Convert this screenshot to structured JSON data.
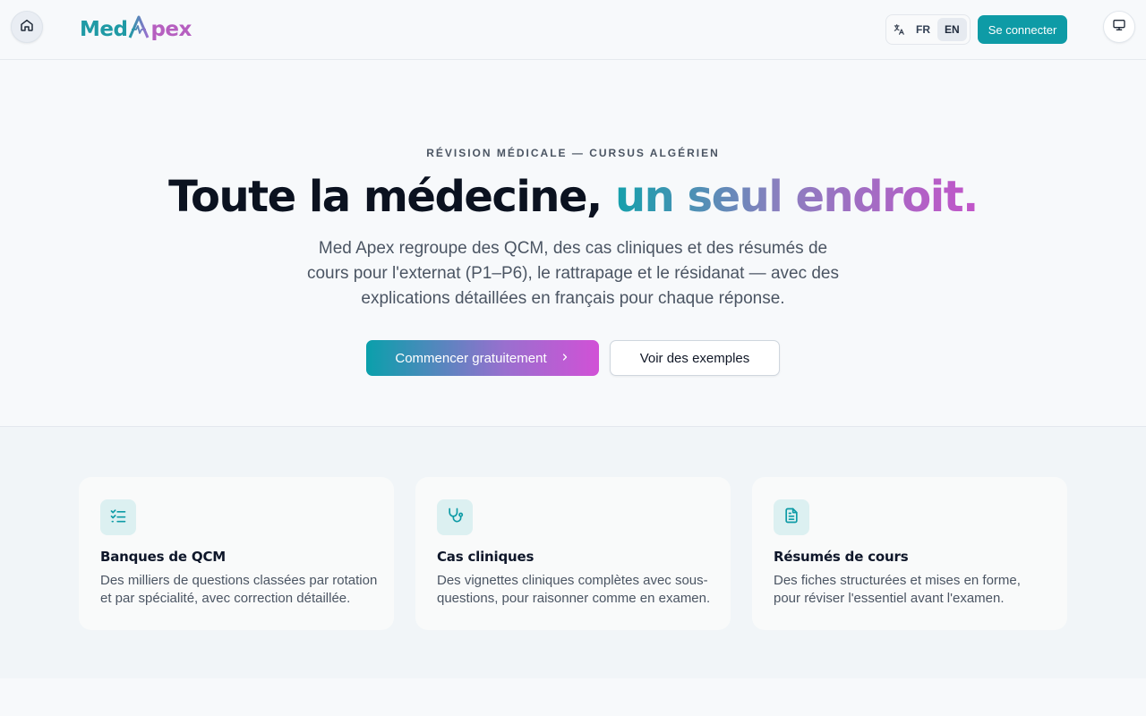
{
  "header": {
    "logo_left": "Med",
    "logo_right": "pex",
    "lang_options": [
      "FR",
      "EN"
    ],
    "lang_selected": "EN",
    "login_label": "Se connecter"
  },
  "hero": {
    "eyebrow": "RÉVISION MÉDICALE — CURSUS ALGÉRIEN",
    "headline_plain": "Toute la médecine,",
    "headline_accent": "un seul endroit.",
    "description": "Med Apex regroupe des QCM, des cas cliniques et des résumés de cours pour l'externat (P1–P6), le rattrapage et le résidanat — avec des explications détaillées en français pour chaque réponse.",
    "cta_primary": "Commencer gratuitement",
    "cta_secondary": "Voir des exemples"
  },
  "features": [
    {
      "icon": "checklist-icon",
      "title": "Banques de QCM",
      "description": "Des milliers de questions classées par rotation et par spécialité, avec correction détaillée."
    },
    {
      "icon": "stethoscope-icon",
      "title": "Cas cliniques",
      "description": "Des vignettes cliniques complètes avec sous-questions, pour raisonner comme en examen."
    },
    {
      "icon": "document-icon",
      "title": "Résumés de cours",
      "description": "Des fiches structurées et mises en forme, pour réviser l'essentiel avant l'examen."
    }
  ],
  "colors": {
    "brand_teal": "#0e9ba6",
    "brand_purple": "#c255c9",
    "page_bg": "#f7f9fb"
  }
}
